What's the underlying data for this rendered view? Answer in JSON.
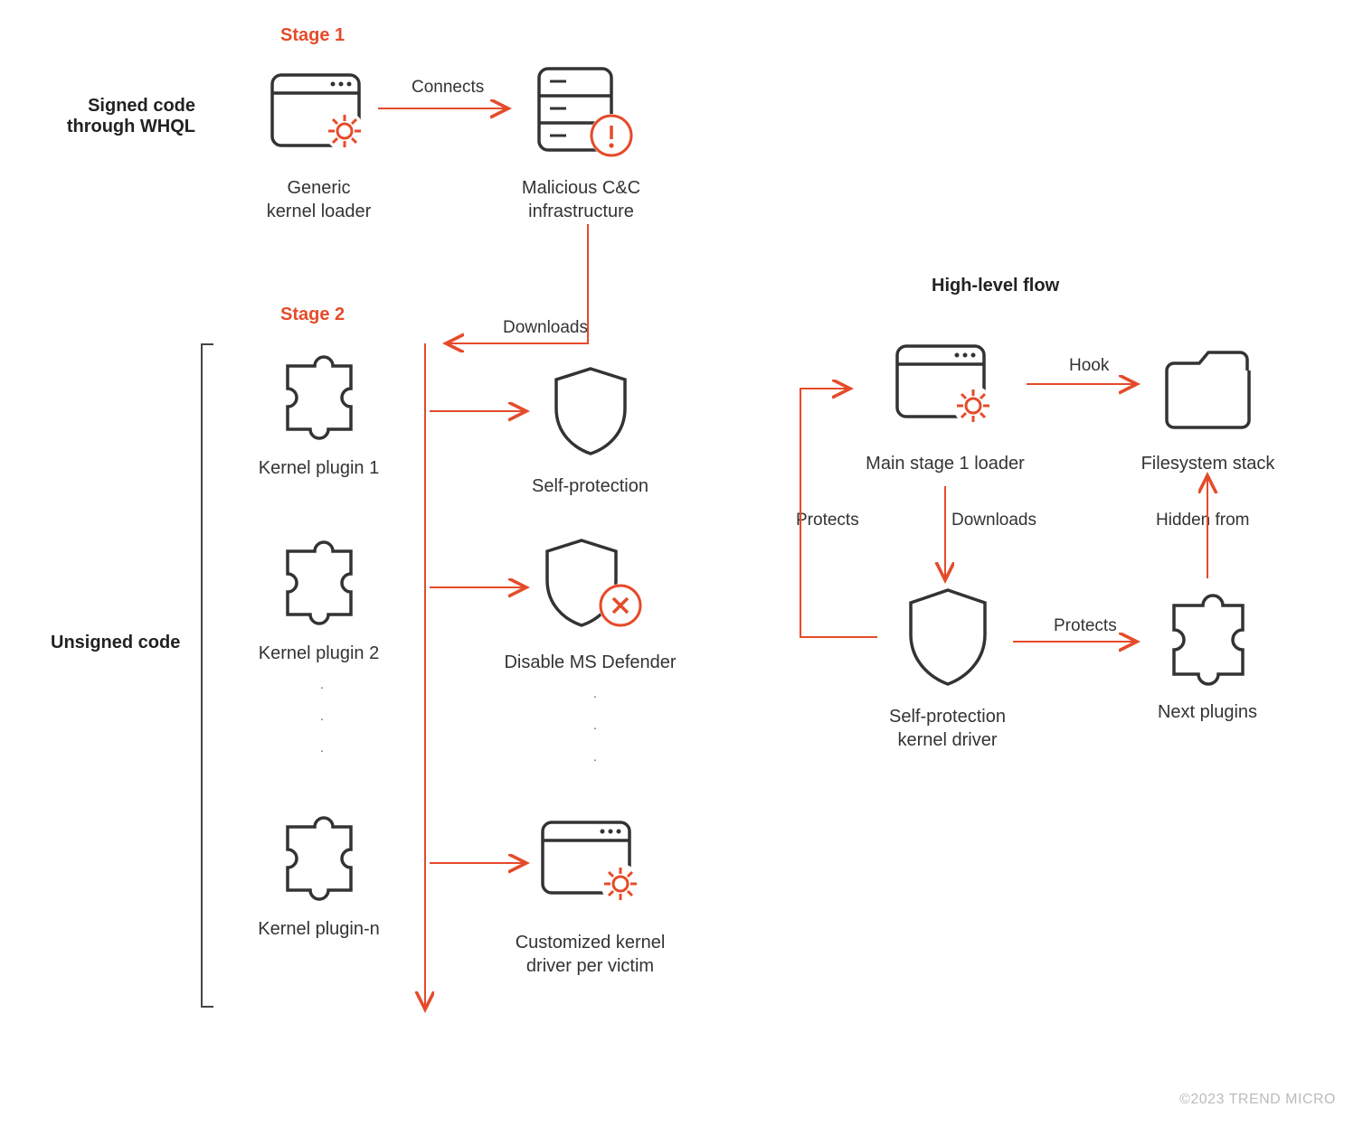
{
  "stages": {
    "s1": "Stage 1",
    "s2": "Stage 2"
  },
  "sections": {
    "whql": "Signed code\nthrough WHQL",
    "unsigned": "Unsigned code",
    "highlevel": "High-level flow"
  },
  "nodes": {
    "genericLoader": "Generic\nkernel loader",
    "cnc": "Malicious C&C\ninfrastructure",
    "plugin1": "Kernel plugin 1",
    "plugin2": "Kernel plugin 2",
    "pluginN": "Kernel plugin-n",
    "selfProtection": "Self-protection",
    "disableDefender": "Disable MS Defender",
    "customDriver": "Customized kernel\ndriver per victim",
    "mainLoader": "Main stage 1 loader",
    "fsStack": "Filesystem stack",
    "spKernelDriver": "Self-protection\nkernel driver",
    "nextPlugins": "Next plugins"
  },
  "edges": {
    "connects": "Connects",
    "downloads": "Downloads",
    "hook": "Hook",
    "protects": "Protects",
    "downloads2": "Downloads",
    "protects2": "Protects",
    "hiddenFrom": "Hidden from"
  },
  "footer": "©2023 TREND MICRO"
}
